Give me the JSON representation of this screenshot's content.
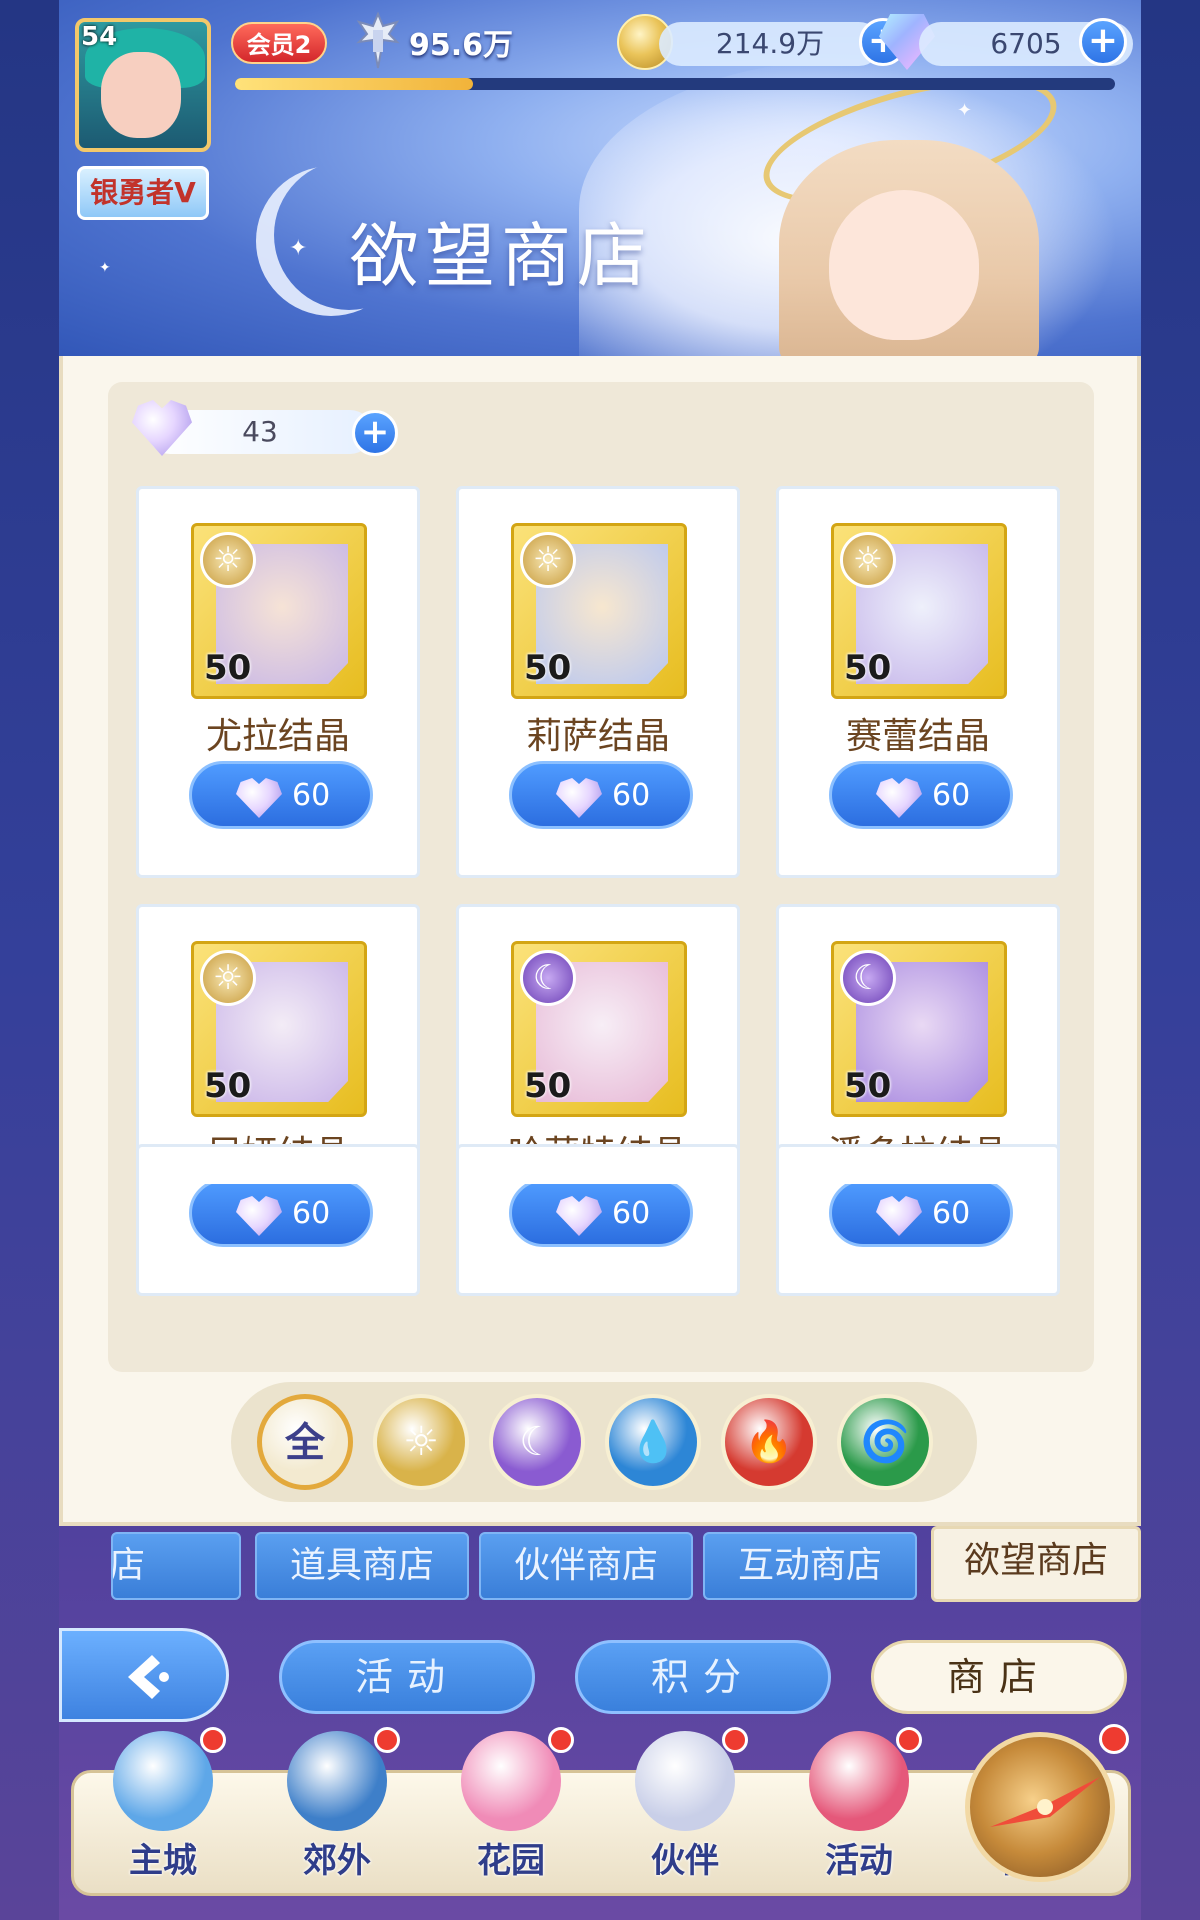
{
  "player": {
    "level": "54",
    "rank_title": "银勇者V",
    "vip_label": "会员2",
    "power": "95.6万",
    "exp_fraction": 0.27
  },
  "currencies": {
    "gold": "214.9万",
    "gems": "6705"
  },
  "header": {
    "shop_title": "欲望商店"
  },
  "shop": {
    "heart_balance": "43",
    "items": [
      {
        "name": "尤拉结晶",
        "quantity": "50",
        "price": "60",
        "element": "light",
        "element_icon": "sun-icon"
      },
      {
        "name": "莉萨结晶",
        "quantity": "50",
        "price": "60",
        "element": "light",
        "element_icon": "sun-icon"
      },
      {
        "name": "赛蕾结晶",
        "quantity": "50",
        "price": "60",
        "element": "light",
        "element_icon": "sun-icon"
      },
      {
        "name": "尼娅结晶",
        "quantity": "50",
        "price": "60",
        "element": "light",
        "element_icon": "sun-icon"
      },
      {
        "name": "哈莉特结晶",
        "quantity": "50",
        "price": "60",
        "element": "dark",
        "element_icon": "moon-icon"
      },
      {
        "name": "潘多拉结晶",
        "quantity": "50",
        "price": "60",
        "element": "dark",
        "element_icon": "moon-icon"
      }
    ]
  },
  "filters": {
    "all_label": "全",
    "options": [
      {
        "name": "all",
        "color": "#f3ead0"
      },
      {
        "name": "light",
        "color": "#d9b34a"
      },
      {
        "name": "dark",
        "color": "#8a5bd1"
      },
      {
        "name": "water",
        "color": "#2d86d6"
      },
      {
        "name": "fire",
        "color": "#d53a30"
      },
      {
        "name": "wind",
        "color": "#2b9a4a"
      }
    ]
  },
  "shop_tabs": [
    "商店",
    "道具商店",
    "伙伴商店",
    "互动商店",
    "欲望商店"
  ],
  "active_tab": "欲望商店",
  "subnav": {
    "activity": "活动",
    "points": "积分",
    "shop": "商店"
  },
  "bottom_nav": [
    {
      "label": "主城",
      "color": "#5ea7e8"
    },
    {
      "label": "郊外",
      "color": "#3e7fc9"
    },
    {
      "label": "花园",
      "color": "#f08bb7"
    },
    {
      "label": "伙伴",
      "color": "#c9cfe8"
    },
    {
      "label": "活动",
      "color": "#e5587a"
    },
    {
      "label": "冒险",
      "color": "#c68a3a"
    }
  ]
}
